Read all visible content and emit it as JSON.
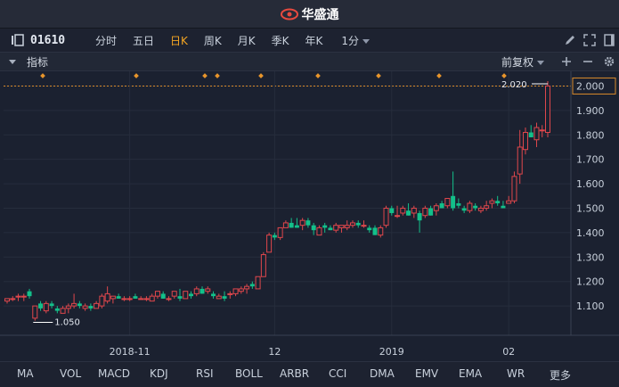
{
  "app": {
    "title": "华盛通"
  },
  "toolbar": {
    "stock_code": "01610",
    "periods": [
      "分时",
      "五日",
      "日K",
      "周K",
      "月K",
      "季K",
      "年K"
    ],
    "active_period": "日K",
    "minute_select": "1分"
  },
  "indicator_bar": {
    "label": "指标",
    "adjust_mode": "前复权"
  },
  "chart_data": {
    "type": "candlestick",
    "title": "",
    "xlabel": "",
    "ylabel": "",
    "ylim": [
      0.98,
      2.06
    ],
    "y_ticks": [
      "2.000",
      "1.900",
      "1.800",
      "1.700",
      "1.600",
      "1.500",
      "1.400",
      "1.300",
      "1.200",
      "1.100"
    ],
    "x_tick_labels": [
      "2018-11",
      "12",
      "2019",
      "02"
    ],
    "annotations": {
      "high_label": "2.020",
      "low_label": "1.050",
      "ref_line": 2.0
    },
    "up_color": "#e0474c",
    "down_color": "#13c08a",
    "candles": [
      [
        1.12,
        1.13,
        1.11,
        1.13
      ],
      [
        1.13,
        1.14,
        1.12,
        1.13
      ],
      [
        1.14,
        1.15,
        1.12,
        1.14
      ],
      [
        1.14,
        1.15,
        1.12,
        1.14
      ],
      [
        1.16,
        1.17,
        1.13,
        1.14
      ],
      [
        1.05,
        1.1,
        1.04,
        1.1
      ],
      [
        1.11,
        1.12,
        1.08,
        1.09
      ],
      [
        1.08,
        1.12,
        1.07,
        1.11
      ],
      [
        1.11,
        1.12,
        1.09,
        1.1
      ],
      [
        1.09,
        1.1,
        1.07,
        1.08
      ],
      [
        1.07,
        1.1,
        1.07,
        1.09
      ],
      [
        1.09,
        1.11,
        1.07,
        1.1
      ],
      [
        1.1,
        1.15,
        1.09,
        1.11
      ],
      [
        1.11,
        1.12,
        1.09,
        1.1
      ],
      [
        1.09,
        1.11,
        1.08,
        1.1
      ],
      [
        1.1,
        1.11,
        1.08,
        1.09
      ],
      [
        1.09,
        1.12,
        1.09,
        1.11
      ],
      [
        1.1,
        1.15,
        1.09,
        1.14
      ],
      [
        1.12,
        1.18,
        1.11,
        1.15
      ],
      [
        1.13,
        1.14,
        1.11,
        1.14
      ],
      [
        1.14,
        1.15,
        1.13,
        1.13
      ],
      [
        1.13,
        1.14,
        1.12,
        1.13
      ],
      [
        1.13,
        1.14,
        1.12,
        1.13
      ],
      [
        1.14,
        1.15,
        1.13,
        1.13
      ],
      [
        1.13,
        1.14,
        1.13,
        1.13
      ],
      [
        1.13,
        1.14,
        1.12,
        1.13
      ],
      [
        1.12,
        1.15,
        1.12,
        1.14
      ],
      [
        1.14,
        1.16,
        1.13,
        1.16
      ],
      [
        1.15,
        1.16,
        1.13,
        1.13
      ],
      [
        1.13,
        1.14,
        1.12,
        1.13
      ],
      [
        1.14,
        1.16,
        1.13,
        1.16
      ],
      [
        1.14,
        1.17,
        1.12,
        1.13
      ],
      [
        1.13,
        1.16,
        1.13,
        1.16
      ],
      [
        1.15,
        1.16,
        1.13,
        1.14
      ],
      [
        1.15,
        1.18,
        1.14,
        1.17
      ],
      [
        1.17,
        1.18,
        1.15,
        1.15
      ],
      [
        1.16,
        1.18,
        1.15,
        1.17
      ],
      [
        1.15,
        1.16,
        1.13,
        1.14
      ],
      [
        1.13,
        1.15,
        1.13,
        1.14
      ],
      [
        1.14,
        1.16,
        1.12,
        1.13
      ],
      [
        1.15,
        1.16,
        1.13,
        1.15
      ],
      [
        1.15,
        1.17,
        1.14,
        1.17
      ],
      [
        1.16,
        1.18,
        1.15,
        1.17
      ],
      [
        1.17,
        1.19,
        1.15,
        1.18
      ],
      [
        1.19,
        1.2,
        1.17,
        1.18
      ],
      [
        1.17,
        1.22,
        1.17,
        1.22
      ],
      [
        1.22,
        1.32,
        1.22,
        1.31
      ],
      [
        1.32,
        1.4,
        1.32,
        1.39
      ],
      [
        1.39,
        1.4,
        1.37,
        1.38
      ],
      [
        1.38,
        1.42,
        1.37,
        1.42
      ],
      [
        1.42,
        1.45,
        1.42,
        1.44
      ],
      [
        1.44,
        1.46,
        1.42,
        1.42
      ],
      [
        1.43,
        1.46,
        1.42,
        1.42
      ],
      [
        1.43,
        1.46,
        1.41,
        1.45
      ],
      [
        1.45,
        1.46,
        1.42,
        1.43
      ],
      [
        1.43,
        1.44,
        1.39,
        1.41
      ],
      [
        1.39,
        1.43,
        1.39,
        1.42
      ],
      [
        1.43,
        1.44,
        1.4,
        1.42
      ],
      [
        1.42,
        1.43,
        1.41,
        1.41
      ],
      [
        1.41,
        1.44,
        1.4,
        1.43
      ],
      [
        1.42,
        1.43,
        1.4,
        1.43
      ],
      [
        1.42,
        1.45,
        1.41,
        1.43
      ],
      [
        1.43,
        1.45,
        1.42,
        1.44
      ],
      [
        1.44,
        1.45,
        1.42,
        1.43
      ],
      [
        1.43,
        1.45,
        1.42,
        1.43
      ],
      [
        1.42,
        1.43,
        1.4,
        1.41
      ],
      [
        1.42,
        1.43,
        1.39,
        1.39
      ],
      [
        1.39,
        1.43,
        1.38,
        1.42
      ],
      [
        1.43,
        1.51,
        1.42,
        1.5
      ],
      [
        1.5,
        1.51,
        1.47,
        1.48
      ],
      [
        1.47,
        1.51,
        1.46,
        1.47
      ],
      [
        1.48,
        1.51,
        1.47,
        1.5
      ],
      [
        1.49,
        1.52,
        1.47,
        1.47
      ],
      [
        1.48,
        1.51,
        1.46,
        1.5
      ],
      [
        1.48,
        1.49,
        1.4,
        1.45
      ],
      [
        1.47,
        1.51,
        1.46,
        1.5
      ],
      [
        1.5,
        1.51,
        1.47,
        1.47
      ],
      [
        1.49,
        1.52,
        1.47,
        1.51
      ],
      [
        1.52,
        1.53,
        1.5,
        1.5
      ],
      [
        1.51,
        1.54,
        1.5,
        1.54
      ],
      [
        1.55,
        1.65,
        1.49,
        1.5
      ],
      [
        1.52,
        1.54,
        1.5,
        1.51
      ],
      [
        1.5,
        1.51,
        1.48,
        1.49
      ],
      [
        1.49,
        1.53,
        1.48,
        1.52
      ],
      [
        1.51,
        1.52,
        1.49,
        1.5
      ],
      [
        1.49,
        1.51,
        1.48,
        1.5
      ],
      [
        1.5,
        1.53,
        1.49,
        1.51
      ],
      [
        1.52,
        1.54,
        1.5,
        1.53
      ],
      [
        1.53,
        1.55,
        1.51,
        1.52
      ],
      [
        1.51,
        1.53,
        1.5,
        1.5
      ],
      [
        1.52,
        1.55,
        1.52,
        1.53
      ],
      [
        1.53,
        1.65,
        1.52,
        1.63
      ],
      [
        1.64,
        1.82,
        1.6,
        1.75
      ],
      [
        1.74,
        1.83,
        1.72,
        1.81
      ],
      [
        1.81,
        1.84,
        1.79,
        1.79
      ],
      [
        1.78,
        1.85,
        1.75,
        1.83
      ],
      [
        1.82,
        1.84,
        1.79,
        1.82
      ],
      [
        1.81,
        2.02,
        1.79,
        2.0
      ]
    ]
  },
  "bottom_indicators": [
    "MA",
    "VOL",
    "MACD",
    "KDJ",
    "RSI",
    "BOLL",
    "ARBR",
    "CCI",
    "DMA",
    "EMV",
    "EMA",
    "WR",
    "更多"
  ]
}
